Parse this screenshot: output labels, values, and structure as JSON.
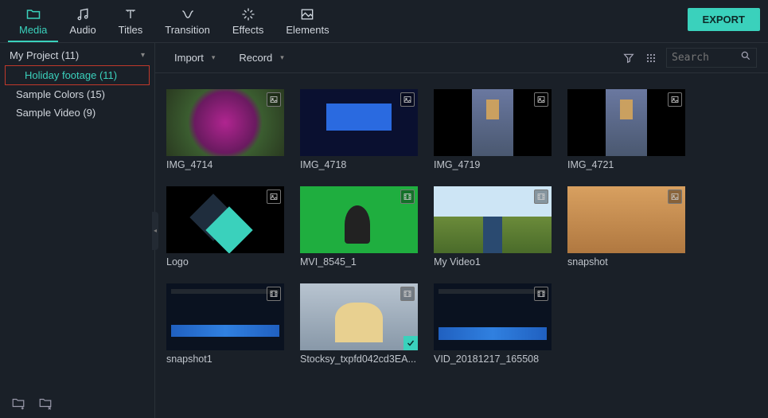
{
  "toolbar": {
    "tabs": [
      {
        "label": "Media",
        "icon": "folder-icon"
      },
      {
        "label": "Audio",
        "icon": "music-icon"
      },
      {
        "label": "Titles",
        "icon": "text-icon"
      },
      {
        "label": "Transition",
        "icon": "transition-icon"
      },
      {
        "label": "Effects",
        "icon": "sparkle-icon"
      },
      {
        "label": "Elements",
        "icon": "image-icon"
      }
    ],
    "active": 0,
    "export_label": "EXPORT"
  },
  "sidebar": {
    "items": [
      {
        "label": "My Project (11)",
        "indent": false,
        "expandable": true
      },
      {
        "label": "Holiday footage (11)",
        "indent": true,
        "highlight": true
      },
      {
        "label": "Sample Colors (15)",
        "indent": false
      },
      {
        "label": "Sample Video (9)",
        "indent": false
      }
    ]
  },
  "actionbar": {
    "import_label": "Import",
    "record_label": "Record",
    "search_placeholder": "Search"
  },
  "media": [
    {
      "name": "IMG_4714",
      "type": "image",
      "thumb": "flowers"
    },
    {
      "name": "IMG_4718",
      "type": "image",
      "thumb": "conf"
    },
    {
      "name": "IMG_4719",
      "type": "image",
      "thumb": "stage",
      "tall": true
    },
    {
      "name": "IMG_4721",
      "type": "image",
      "thumb": "stage",
      "tall": true
    },
    {
      "name": "Logo",
      "type": "image",
      "thumb": "logo-ph"
    },
    {
      "name": "MVI_8545_1",
      "type": "video",
      "thumb": "green"
    },
    {
      "name": "My Video1",
      "type": "video",
      "thumb": "landscape"
    },
    {
      "name": "snapshot",
      "type": "image",
      "thumb": "beach"
    },
    {
      "name": "snapshot1",
      "type": "video",
      "thumb": "editor"
    },
    {
      "name": "Stocksy_txpfd042cd3EA...",
      "type": "video",
      "thumb": "people",
      "checked": true
    },
    {
      "name": "VID_20181217_165508",
      "type": "video",
      "thumb": "editor editor2"
    }
  ],
  "colors": {
    "accent": "#3ad1bc"
  }
}
